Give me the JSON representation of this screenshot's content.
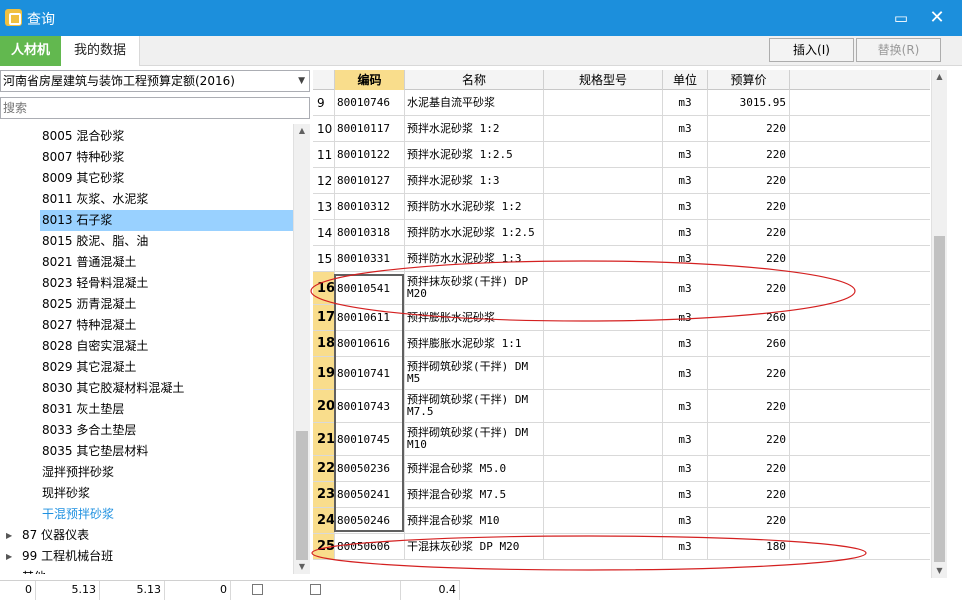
{
  "window": {
    "title": "查询",
    "minimize_label": "▭",
    "close_label": "✕"
  },
  "tabs": [
    {
      "label": "人材机"
    },
    {
      "label": "我的数据"
    }
  ],
  "buttons": {
    "insert": "插入(I)",
    "replace": "替换(R)"
  },
  "left_panel": {
    "quota_library": "河南省房屋建筑与装饰工程预算定额(2016)",
    "search_placeholder": "搜索",
    "tree_items": [
      {
        "label": "8005 混合砂浆",
        "level": 2
      },
      {
        "label": "8007 特种砂浆",
        "level": 2
      },
      {
        "label": "8009 其它砂浆",
        "level": 2
      },
      {
        "label": "8011 灰浆、水泥浆",
        "level": 2
      },
      {
        "label": "8013 石子浆",
        "level": 2,
        "selected": true
      },
      {
        "label": "8015 胶泥、脂、油",
        "level": 2
      },
      {
        "label": "8021 普通混凝土",
        "level": 2
      },
      {
        "label": "8023 轻骨料混凝土",
        "level": 2
      },
      {
        "label": "8025 沥青混凝土",
        "level": 2
      },
      {
        "label": "8027 特种混凝土",
        "level": 2
      },
      {
        "label": "8028 自密实混凝土",
        "level": 2
      },
      {
        "label": "8029 其它混凝土",
        "level": 2
      },
      {
        "label": "8030 其它胶凝材料混凝土",
        "level": 2
      },
      {
        "label": "8031 灰土垫层",
        "level": 2
      },
      {
        "label": "8033 多合土垫层",
        "level": 2
      },
      {
        "label": "8035 其它垫层材料",
        "level": 2
      },
      {
        "label": "湿拌预拌砂浆",
        "level": 2
      },
      {
        "label": "现拌砂浆",
        "level": 2
      },
      {
        "label": "干混预拌砂浆",
        "level": 2,
        "highlight": true
      },
      {
        "label": "87 仪器仪表",
        "level": 1,
        "collapsed": true
      },
      {
        "label": "99 工程机械台班",
        "level": 1,
        "collapsed": true
      },
      {
        "label": "其他",
        "level": 1
      }
    ]
  },
  "bottom_row": {
    "c1": "0",
    "c2": "5.13",
    "c3": "5.13",
    "c4": "0",
    "c5": "0.4"
  },
  "grid": {
    "columns": {
      "code": "编码",
      "name": "名称",
      "spec": "规格型号",
      "unit": "单位",
      "price": "预算价"
    },
    "rows": [
      {
        "num": "9",
        "code": "80010746",
        "name": "水泥基自流平砂浆",
        "spec": "",
        "unit": "m3",
        "price": "3015.95"
      },
      {
        "num": "10",
        "code": "80010117",
        "name": "预拌水泥砂浆 1:2",
        "spec": "",
        "unit": "m3",
        "price": "220"
      },
      {
        "num": "11",
        "code": "80010122",
        "name": "预拌水泥砂浆 1:2.5",
        "spec": "",
        "unit": "m3",
        "price": "220"
      },
      {
        "num": "12",
        "code": "80010127",
        "name": "预拌水泥砂浆 1:3",
        "spec": "",
        "unit": "m3",
        "price": "220"
      },
      {
        "num": "13",
        "code": "80010312",
        "name": "预拌防水水泥砂浆 1:2",
        "spec": "",
        "unit": "m3",
        "price": "220"
      },
      {
        "num": "14",
        "code": "80010318",
        "name": "预拌防水水泥砂浆 1:2.5",
        "spec": "",
        "unit": "m3",
        "price": "220"
      },
      {
        "num": "15",
        "code": "80010331",
        "name": "预拌防水水泥砂浆 1:3",
        "spec": "",
        "unit": "m3",
        "price": "220"
      },
      {
        "num": "16",
        "code": "80010541",
        "name": "预拌抹灰砂浆(干拌) DP M20",
        "spec": "",
        "unit": "m3",
        "price": "220"
      },
      {
        "num": "17",
        "code": "80010611",
        "name": "预拌膨胀水泥砂浆",
        "spec": "",
        "unit": "m3",
        "price": "260"
      },
      {
        "num": "18",
        "code": "80010616",
        "name": "预拌膨胀水泥砂浆 1:1",
        "spec": "",
        "unit": "m3",
        "price": "260"
      },
      {
        "num": "19",
        "code": "80010741",
        "name": "预拌砌筑砂浆(干拌) DM M5",
        "spec": "",
        "unit": "m3",
        "price": "220"
      },
      {
        "num": "20",
        "code": "80010743",
        "name": "预拌砌筑砂浆(干拌) DM M7.5",
        "spec": "",
        "unit": "m3",
        "price": "220"
      },
      {
        "num": "21",
        "code": "80010745",
        "name": "预拌砌筑砂浆(干拌) DM M10",
        "spec": "",
        "unit": "m3",
        "price": "220"
      },
      {
        "num": "22",
        "code": "80050236",
        "name": "预拌混合砂浆 M5.0",
        "spec": "",
        "unit": "m3",
        "price": "220"
      },
      {
        "num": "23",
        "code": "80050241",
        "name": "预拌混合砂浆 M7.5",
        "spec": "",
        "unit": "m3",
        "price": "220"
      },
      {
        "num": "24",
        "code": "80050246",
        "name": "预拌混合砂浆 M10",
        "spec": "",
        "unit": "m3",
        "price": "220"
      },
      {
        "num": "25",
        "code": "80050606",
        "name": "干混抹灰砂浆 DP M20",
        "spec": "",
        "unit": "m3",
        "price": "180"
      }
    ]
  },
  "annotation_color": "#d42020",
  "selection_color": "#f9dd8c"
}
